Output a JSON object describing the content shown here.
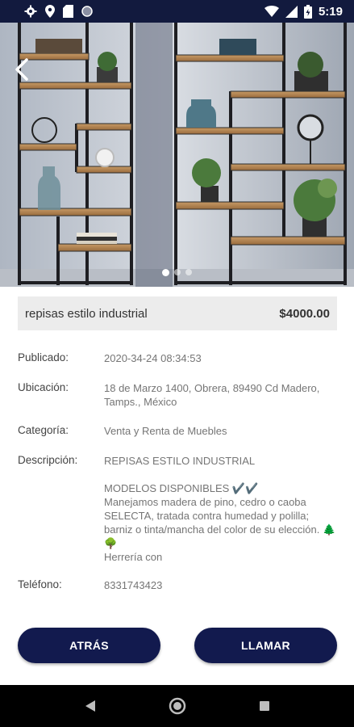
{
  "status_bar": {
    "time": "5:19",
    "icons": [
      "gear-icon",
      "location-icon",
      "sd-card-icon",
      "circle-icon",
      "wifi-icon",
      "signal-icon",
      "battery-icon"
    ]
  },
  "hero": {
    "carousel_index": 1,
    "carousel_count": 3
  },
  "listing": {
    "title": "repisas estilo industrial",
    "price": "$4000.00"
  },
  "details": {
    "published_label": "Publicado:",
    "published_value": "2020-34-24 08:34:53",
    "location_label": "Ubicación:",
    "location_value": "18 de Marzo 1400, Obrera, 89490 Cd Madero,\nTamps., México",
    "category_label": "Categoría:",
    "category_value": "Venta y Renta de Muebles",
    "description_label": "Descripción:",
    "description_value": "REPISAS ESTILO INDUSTRIAL\n\nMODELOS DISPONIBLES ✔️✔️\nManejamos madera de pino, cedro o caoba SELECTA, tratada contra humedad y polilla; barniz o tinta/mancha del color de su elección. 🌲🌳\nHerrería con",
    "phone_label": "Teléfono:",
    "phone_value": "8331743423"
  },
  "buttons": {
    "back_label": "ATRÁS",
    "call_label": "LLAMAR"
  },
  "colors": {
    "primary": "#121a4e",
    "status_bar": "#121a3e",
    "title_bg": "#ececec"
  }
}
